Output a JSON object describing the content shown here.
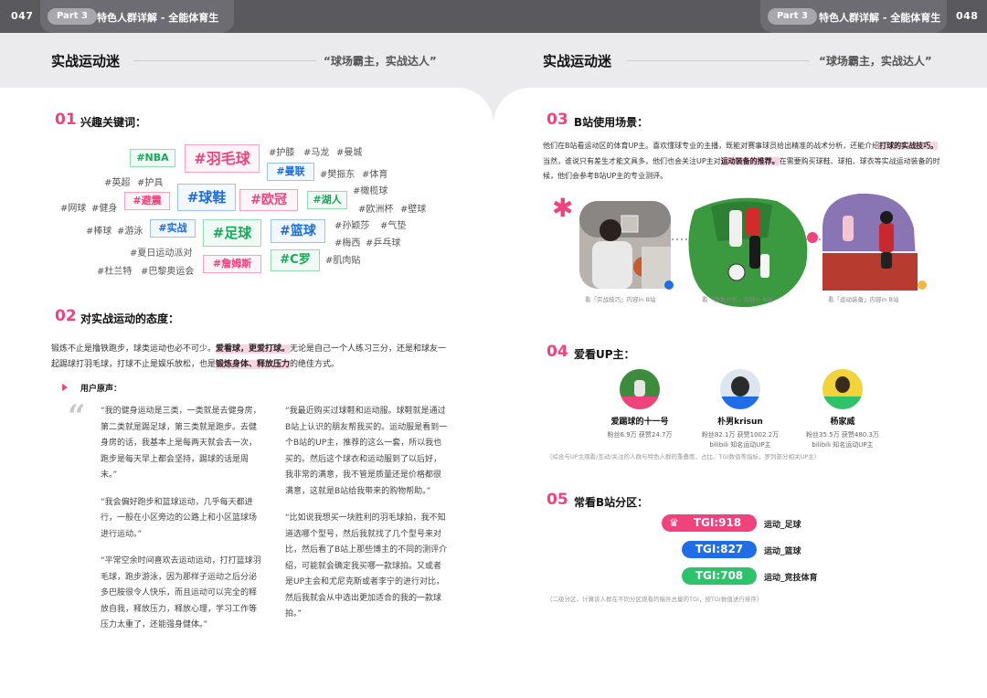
{
  "header": {
    "left_page": "047",
    "right_page": "048",
    "part_label": "Part 3",
    "part_title": "特色人群详解 - 全能体育生"
  },
  "left": {
    "section_title": "实战运动迷",
    "section_quote": "“球场霸主，实战达人”",
    "s01": {
      "num": "01",
      "title": "兴趣关键词：",
      "tags_boxed": [
        {
          "text": "#NBA",
          "color": "green"
        },
        {
          "text": "#羽毛球",
          "color": "pink"
        },
        {
          "text": "#曼联",
          "color": "blue"
        },
        {
          "text": "#避震",
          "color": "pink"
        },
        {
          "text": "#球鞋",
          "color": "blue"
        },
        {
          "text": "#欧冠",
          "color": "pink"
        },
        {
          "text": "#湖人",
          "color": "green"
        },
        {
          "text": "#实战",
          "color": "blue"
        },
        {
          "text": "#足球",
          "color": "green"
        },
        {
          "text": "#篮球",
          "color": "blue"
        },
        {
          "text": "#詹姆斯",
          "color": "pink"
        },
        {
          "text": "#C罗",
          "color": "green"
        }
      ],
      "tags_plain": [
        "#护膝",
        "#马龙",
        "#曼城",
        "#樊振东",
        "#体育",
        "#英超",
        "#护具",
        "#橄榄球",
        "#网球",
        "#健身",
        "#欧洲杯",
        "#壁球",
        "#棒球",
        "#游泳",
        "#孙颖莎",
        "#气垫",
        "#梅西",
        "#乒乓球",
        "#夏日运动派对",
        "#杜兰特",
        "#巴黎奥运会",
        "#肌肉贴"
      ]
    },
    "s02": {
      "num": "02",
      "title": "对实战运动的态度：",
      "para_a": "锻炼不止是撸铁跑步，球类运动也必不可少。",
      "para_hl1": "爱看球，更爱打球。",
      "para_b": "无论是自己一个人练习三分，还是和球友一起踢球打羽毛球，打球不止是娱乐放松，也是",
      "para_hl2": "锻炼身体、释放压力",
      "para_c": "的绝佳方式。",
      "voice_label": "用户原声：",
      "quotes_col1": [
        "“我的健身运动是三类，一类就是去健身房，第二类就是踢足球，第三类就是跑步。去健身房的话，我基本上是每两天就会去一次，跑步是每天早上都会坚持，踢球的话是周末。”",
        "“我会偏好跑步和篮球运动，几乎每天都进行，一般在小区旁边的公路上和小区篮球场进行运动。”",
        "“平常空余时间喜欢去运动运动，打打篮球羽毛球，跑步游泳，因为那样子运动之后分泌多巴胺很令人快乐，而且运动可以完全的释放自我，释放压力，释放心理，学习工作等压力太重了，还能强身健体。”"
      ],
      "quotes_col2": [
        "“我最近购买过球鞋和运动服。球鞋就是通过B站上认识的朋友帮我买的。运动服是看到一个B站的UP主，推荐的这么一套，所以我也买的。然后这个球衣和运动服到了以后好，我非常的满意，我不管是质量还是价格都很满意，这就是B站给我带来的购物帮助。”",
        "“比如说我想买一块胜利的羽毛球拍，我不知道选哪个型号，然后我就找了几个型号来对比，然后看了B站上那些博主的不同的测评介绍，可能就会确定我买哪一款球拍。又或者是UP主会和尤尼克斯或者李宁的进行对比，然后我就会从中选出更加适合的我的一款球拍。”"
      ]
    }
  },
  "right": {
    "section_title": "实战运动迷",
    "section_quote": "“球场霸主，实战达人”",
    "s03": {
      "num": "03",
      "title": "B站使用场景：",
      "para_a": "他们在B站看运动区的体育UP主。喜欢懂球专业的主播，既能对赛事球员给出精准的战术分析，还能介绍",
      "para_hl1": "打球的实战技巧。",
      "para_b": "当然，谁说只有差生才能文具多，他们也会关注UP主对",
      "para_hl2": "运动装备的推荐。",
      "para_c": "在需要购买球鞋、球拍、球衣等实战运动装备的时候，他们会参考B站UP主的专业测评。",
      "captions": [
        "看「实战技巧」内容in B站",
        "看「赛事分析」内容in B站",
        "看「运动装备」内容in B站"
      ],
      "dot_colors": [
        "#1f6ee8",
        "#f0427c",
        "#f3b73c"
      ]
    },
    "s04": {
      "num": "04",
      "title": "爱看UP主：",
      "uploaders": [
        {
          "name": "爱踢球的十一号",
          "stats": "粉丝6.9万  获赞24.7万",
          "extra": ""
        },
        {
          "name": "朴男krisun",
          "stats": "粉丝82.1万  获赞1002.2万",
          "extra": "bilibili 知名运动UP主"
        },
        {
          "name": "杨家威",
          "stats": "粉丝35.5万  获赞480.3万",
          "extra": "bilibili 知名运动UP主"
        }
      ],
      "note": "（综合与UP主观看/互动/关注的人群与特色人群的重叠度、占比、TGI数值等指标，罗列部分相关UP主）"
    },
    "s05": {
      "num": "05",
      "title": "常看B站分区：",
      "bars": [
        {
          "label": "TGI:918",
          "category": "运动_足球",
          "color": "#f0427c"
        },
        {
          "label": "TGI:827",
          "category": "运动_篮球",
          "color": "#1f6ee8"
        },
        {
          "label": "TGI:708",
          "category": "运动_竞技体育",
          "color": "#2ec36a"
        }
      ],
      "note": "（二级分区，计算该人群在不同分区观看的稿件总量的TGI，按TGI数值进行排序）"
    }
  }
}
